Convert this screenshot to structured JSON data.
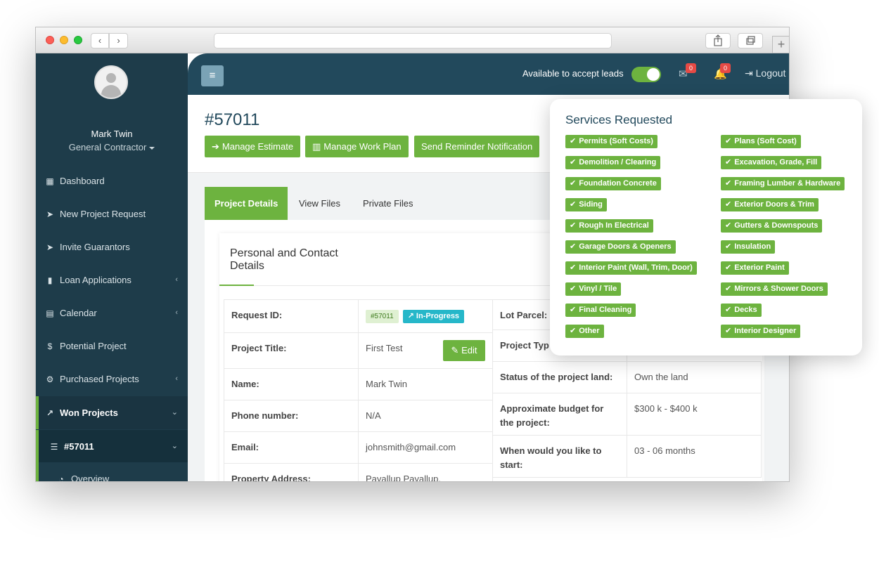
{
  "browser": {
    "back": "‹",
    "forward": "›",
    "new_tab": "+"
  },
  "sidebar": {
    "user_name": "Mark Twin",
    "user_role": "General Contractor",
    "items": [
      {
        "label": "Dashboard",
        "icon": "dashboard-icon"
      },
      {
        "label": "New Project Request",
        "icon": "paper-plane-icon"
      },
      {
        "label": "Invite Guarantors",
        "icon": "paper-plane-icon"
      },
      {
        "label": "Loan Applications",
        "icon": "file-icon"
      },
      {
        "label": "Calendar",
        "icon": "calendar-icon"
      },
      {
        "label": "Potential Project",
        "icon": "dollar-icon"
      },
      {
        "label": "Purchased Projects",
        "icon": "gears-icon"
      },
      {
        "label": "Won Projects",
        "icon": "line-chart-icon"
      },
      {
        "label": "#57011",
        "icon": "list-icon"
      },
      {
        "label": "Overview",
        "icon": "dashboard-gauge-icon"
      }
    ]
  },
  "header": {
    "availability_label": "Available to accept leads",
    "availability_on": true,
    "mail_count": "0",
    "notification_count": "0",
    "logout_label": "Logout"
  },
  "page": {
    "id": "#57011",
    "buttons": {
      "manage_estimate": "Manage Estimate",
      "manage_work_plan": "Manage Work Plan",
      "send_reminder": "Send Reminder Notification"
    },
    "tabs": [
      "Project Details",
      "View Files",
      "Private Files"
    ],
    "card_title": "Personal and Contact Details",
    "details_left": [
      {
        "label": "Request ID:",
        "badge": "#57011",
        "status": "In-Progress"
      },
      {
        "label": "Project Title:",
        "value": "First Test",
        "edit": "Edit"
      },
      {
        "label": "Name:",
        "value": "Mark Twin"
      },
      {
        "label": "Phone number:",
        "value": "N/A"
      },
      {
        "label": "Email:",
        "value": "johnsmith@gmail.com"
      },
      {
        "label": "Property Address:",
        "value": "Payallup Payallup,"
      }
    ],
    "details_right": [
      {
        "label": "Lot Parcel:",
        "value": ""
      },
      {
        "label": "Project Typ",
        "value": ""
      },
      {
        "label": "Status of the project land:",
        "value": "Own the land"
      },
      {
        "label": "Approximate budget for the project:",
        "value": "$300 k - $400 k"
      },
      {
        "label": "When would you like to start:",
        "value": "03 - 06 months"
      }
    ]
  },
  "services": {
    "title": "Services Requested",
    "left": [
      "Permits (Soft Costs)",
      "Demolition / Clearing",
      "Foundation Concrete",
      "Siding",
      "Rough In Electrical",
      "Garage Doors & Openers",
      "Interior Paint (Wall, Trim, Door)",
      "Vinyl / Tile",
      "Final Cleaning",
      "Other"
    ],
    "right": [
      "Plans (Soft Cost)",
      "Excavation, Grade, Fill",
      "Framing Lumber & Hardware",
      "Exterior Doors & Trim",
      "Gutters & Downspouts",
      "Insulation",
      "Exterior Paint",
      "Mirrors & Shower Doors",
      "Decks",
      "Interior Designer"
    ]
  },
  "colors": {
    "accent_green": "#6db33f",
    "sidebar_bg": "#1e3c4a",
    "header_bg": "#22495c",
    "status_blue": "#26b7c9",
    "badge_red": "#e64a45"
  }
}
